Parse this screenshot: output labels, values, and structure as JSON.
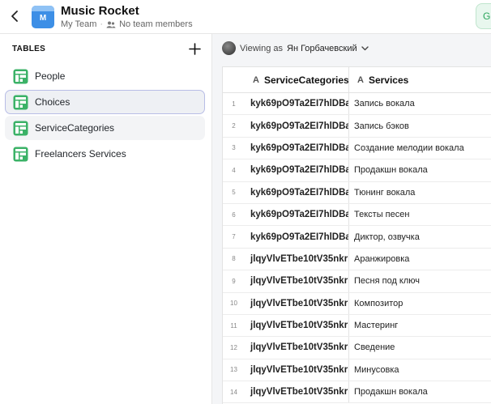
{
  "header": {
    "app_icon_letter": "M",
    "title": "Music Rocket",
    "team": "My Team",
    "separator": "·",
    "members": "No team members",
    "right_glyph": "G"
  },
  "sidebar": {
    "heading": "TABLES",
    "items": [
      {
        "label": "People"
      },
      {
        "label": "Choices"
      },
      {
        "label": "ServiceCategories"
      },
      {
        "label": "Freelancers Services"
      }
    ]
  },
  "main": {
    "viewing_prefix": "Viewing as",
    "viewing_user": "Ян Горбачевский",
    "columns": [
      {
        "type_glyph": "A",
        "label": "ServiceCategories"
      },
      {
        "type_glyph": "A",
        "label": "Services"
      }
    ],
    "rows": [
      {
        "n": "1",
        "cat": "kyk69pO9Ta2EI7hlDBa",
        "svc": "Запись вокала"
      },
      {
        "n": "2",
        "cat": "kyk69pO9Ta2EI7hlDBa",
        "svc": "Запись бэков"
      },
      {
        "n": "3",
        "cat": "kyk69pO9Ta2EI7hlDBa",
        "svc": "Создание мелодии вокала"
      },
      {
        "n": "4",
        "cat": "kyk69pO9Ta2EI7hlDBa",
        "svc": "Продакшн вокала"
      },
      {
        "n": "5",
        "cat": "kyk69pO9Ta2EI7hlDBa",
        "svc": "Тюнинг вокала"
      },
      {
        "n": "6",
        "cat": "kyk69pO9Ta2EI7hlDBa",
        "svc": "Тексты песен"
      },
      {
        "n": "7",
        "cat": "kyk69pO9Ta2EI7hlDBa",
        "svc": "Диктор, озвучка"
      },
      {
        "n": "8",
        "cat": "jlqyVlvETbe10tV35nkr",
        "svc": "Аранжировка"
      },
      {
        "n": "9",
        "cat": "jlqyVlvETbe10tV35nkr",
        "svc": "Песня под ключ"
      },
      {
        "n": "10",
        "cat": "jlqyVlvETbe10tV35nkr",
        "svc": "Композитор"
      },
      {
        "n": "11",
        "cat": "jlqyVlvETbe10tV35nkr",
        "svc": "Мастеринг"
      },
      {
        "n": "12",
        "cat": "jlqyVlvETbe10tV35nkr",
        "svc": "Сведение"
      },
      {
        "n": "13",
        "cat": "jlqyVlvETbe10tV35nkr",
        "svc": "Минусовка"
      },
      {
        "n": "14",
        "cat": "jlqyVlvETbe10tV35nkr",
        "svc": "Продакшн вокала"
      }
    ]
  },
  "colors": {
    "accent_green": "#3bb267",
    "app_icon_blue": "#3d8fe6",
    "selection_border": "#b8bde6"
  },
  "icons": {
    "back": "chevron-left-icon",
    "add": "plus-icon",
    "table": "table-icon",
    "members": "people-icon",
    "dropdown": "chevron-down-icon"
  }
}
